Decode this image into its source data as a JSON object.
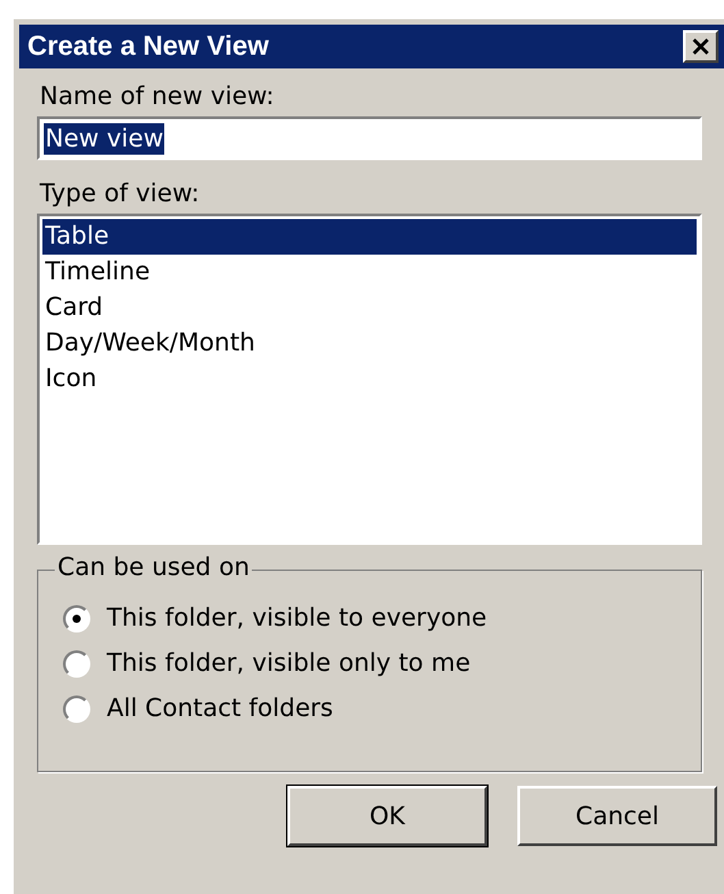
{
  "window": {
    "title": "Create a New View"
  },
  "name_field": {
    "label": "Name of new view:",
    "value": "New view",
    "value_selected": true
  },
  "type_list": {
    "label": "Type of view:",
    "items": [
      {
        "label": "Table",
        "selected": true
      },
      {
        "label": "Timeline",
        "selected": false
      },
      {
        "label": "Card",
        "selected": false
      },
      {
        "label": "Day/Week/Month",
        "selected": false
      },
      {
        "label": "Icon",
        "selected": false
      }
    ]
  },
  "usage_group": {
    "title": "Can be used on",
    "options": [
      {
        "label": "This folder, visible to everyone",
        "selected": true
      },
      {
        "label": "This folder, visible only to me",
        "selected": false
      },
      {
        "label": "All Contact folders",
        "selected": false
      }
    ]
  },
  "buttons": [
    "OK",
    "Cancel"
  ]
}
